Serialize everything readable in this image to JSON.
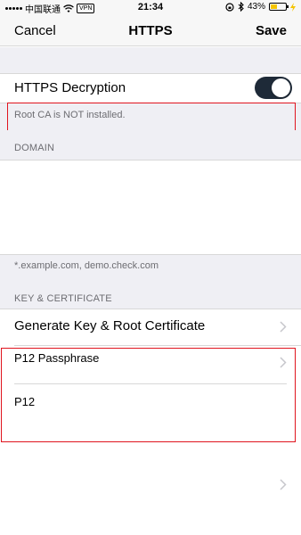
{
  "status_bar": {
    "carrier": "中国联通",
    "vpn": "VPN",
    "time": "21:34",
    "battery": "43%",
    "battery_level": 0.43
  },
  "nav": {
    "cancel": "Cancel",
    "title": "HTTPS",
    "save": "Save"
  },
  "decryption": {
    "label": "HTTPS Decryption",
    "enabled": true,
    "note": "Root CA is NOT installed."
  },
  "domain": {
    "header": "DOMAIN",
    "value": "",
    "footer": "*.example.com, demo.check.com"
  },
  "key_cert": {
    "header": "KEY & CERTIFICATE",
    "generate_label": "Generate Key & Root Certificate",
    "p12_passphrase_label": "P12 Passphrase",
    "p12_label": "P12"
  },
  "colors": {
    "toggle_on": "#1e2a38",
    "highlight_box": "#e0141e",
    "group_background": "#efeff4"
  }
}
